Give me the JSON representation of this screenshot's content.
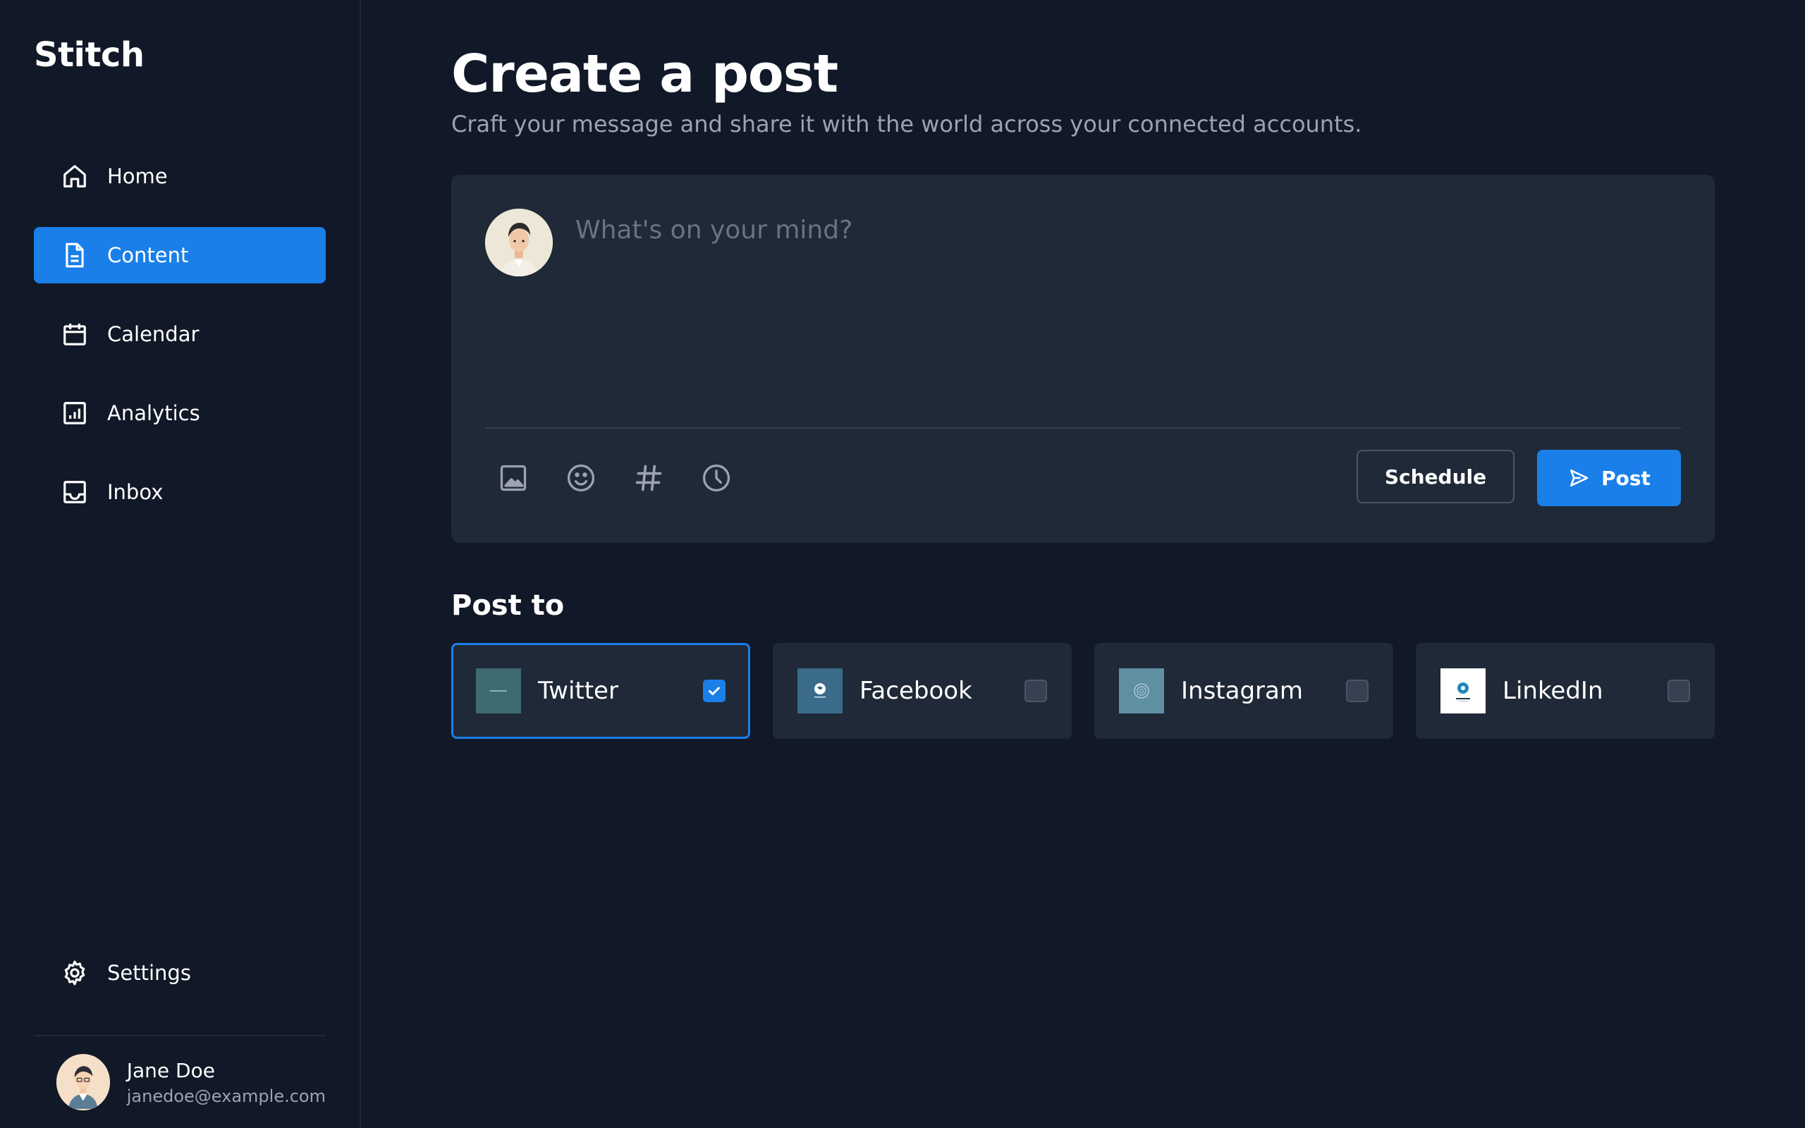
{
  "app": {
    "brand": "Stitch"
  },
  "sidebar": {
    "items": [
      {
        "label": "Home",
        "icon": "home-icon"
      },
      {
        "label": "Content",
        "icon": "document-icon"
      },
      {
        "label": "Calendar",
        "icon": "calendar-icon"
      },
      {
        "label": "Analytics",
        "icon": "analytics-icon"
      },
      {
        "label": "Inbox",
        "icon": "inbox-icon"
      }
    ],
    "active": "Content",
    "settings_label": "Settings"
  },
  "user": {
    "name": "Jane Doe",
    "email": "janedoe@example.com"
  },
  "main": {
    "title": "Create a post",
    "subtitle": "Craft your message and share it with the world across your connected accounts."
  },
  "composer": {
    "placeholder": "What's on your mind?",
    "tools": [
      "image-icon",
      "emoji-icon",
      "hashtag-icon",
      "clock-icon"
    ],
    "schedule_label": "Schedule",
    "post_label": "Post"
  },
  "post_to": {
    "title": "Post to",
    "platforms": [
      {
        "name": "Twitter",
        "checked": true
      },
      {
        "name": "Facebook",
        "checked": false
      },
      {
        "name": "Instagram",
        "checked": false
      },
      {
        "name": "LinkedIn",
        "checked": false
      }
    ]
  },
  "colors": {
    "background": "#111827",
    "panel": "#1f2937",
    "accent": "#1a7fe8",
    "muted_text": "#9ca3af"
  }
}
